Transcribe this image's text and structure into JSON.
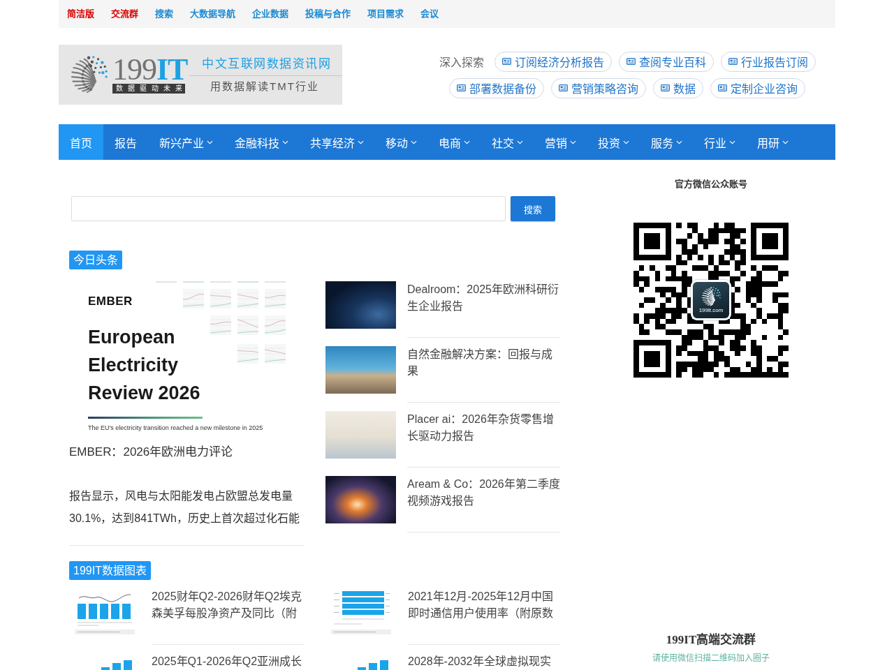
{
  "top_links": [
    {
      "label": "简洁版",
      "color": "#d90000"
    },
    {
      "label": "交流群",
      "color": "#d90000"
    },
    {
      "label": "搜索",
      "color": "#1a8ad4"
    },
    {
      "label": "大数据导航",
      "color": "#1a8ad4"
    },
    {
      "label": "企业数据",
      "color": "#1a8ad4"
    },
    {
      "label": "投稿与合作",
      "color": "#1a8ad4"
    },
    {
      "label": "项目需求",
      "color": "#1a8ad4"
    },
    {
      "label": "会议",
      "color": "#1a8ad4"
    }
  ],
  "logo": {
    "brand": "199**IT**",
    "slogan": "数据驱动未来",
    "site_name": "中文互联网数据资讯网",
    "tagline": "用数据解读TMT行业"
  },
  "explore": {
    "label": "深入探索",
    "rows": [
      {
        "links": [
          "订阅经济分析报告",
          "查阅专业百科",
          "行业报告订阅"
        ]
      },
      {
        "links": [
          "部署数据备份",
          "营销策略咨询",
          "数据",
          "定制企业咨询"
        ]
      }
    ]
  },
  "nav": [
    {
      "label": "首页",
      "selected": true,
      "dropdown": false
    },
    {
      "label": "报告",
      "selected": false,
      "dropdown": false
    },
    {
      "label": "新兴产业",
      "selected": false,
      "dropdown": true
    },
    {
      "label": "金融科技",
      "selected": false,
      "dropdown": true
    },
    {
      "label": "共享经济",
      "selected": false,
      "dropdown": true
    },
    {
      "label": "移动",
      "selected": false,
      "dropdown": true
    },
    {
      "label": "电商",
      "selected": false,
      "dropdown": true
    },
    {
      "label": "社交",
      "selected": false,
      "dropdown": true
    },
    {
      "label": "营销",
      "selected": false,
      "dropdown": true
    },
    {
      "label": "投资",
      "selected": false,
      "dropdown": true
    },
    {
      "label": "服务",
      "selected": false,
      "dropdown": true
    },
    {
      "label": "行业",
      "selected": false,
      "dropdown": true
    },
    {
      "label": "用研",
      "selected": false,
      "dropdown": true
    }
  ],
  "search": {
    "button": "搜索"
  },
  "headlines": {
    "label": "今日头条",
    "featured": {
      "cover": {
        "brand": "EMBER",
        "title": "European Electricity Review 2026",
        "subtitle": "The EU's electricity transition reached a new milestone in 2025"
      },
      "title": "EMBER：2026年欧洲电力评论",
      "excerpt": "报告显示，风电与太阳能发电占欧盟总发电量30.1%，达到841TWh，历史上首次超过化石能"
    },
    "items": [
      {
        "title": "Dealroom：2025年欧洲科研衍生企业报告"
      },
      {
        "title": "自然金融解决方案：回报与成果"
      },
      {
        "title": "Placer ai：2026年杂货零售增长驱动力报告"
      },
      {
        "title": "Aream & Co：2026年第二季度视频游戏报告"
      }
    ]
  },
  "charts": {
    "label": "199IT数据图表",
    "items": [
      {
        "kind": "combo",
        "title": "2025财年Q2-2026财年Q2埃克森美孚每股净资产及同比（附"
      },
      {
        "kind": "hbar",
        "title": "2021年12月-2025年12月中国即时通信用户使用率（附原数"
      },
      {
        "kind": "column",
        "title": "2025年Q1-2026年Q2亚洲成长"
      },
      {
        "kind": "column",
        "title": "2028年-2032年全球虚拟现实"
      }
    ]
  },
  "sidebar": {
    "wechat_title": "官方微信公众账号",
    "qr_logo_text": "199it.com",
    "group_title": "199IT高端交流群",
    "group_hint": "请使用微信扫描二维码加入圈子"
  }
}
